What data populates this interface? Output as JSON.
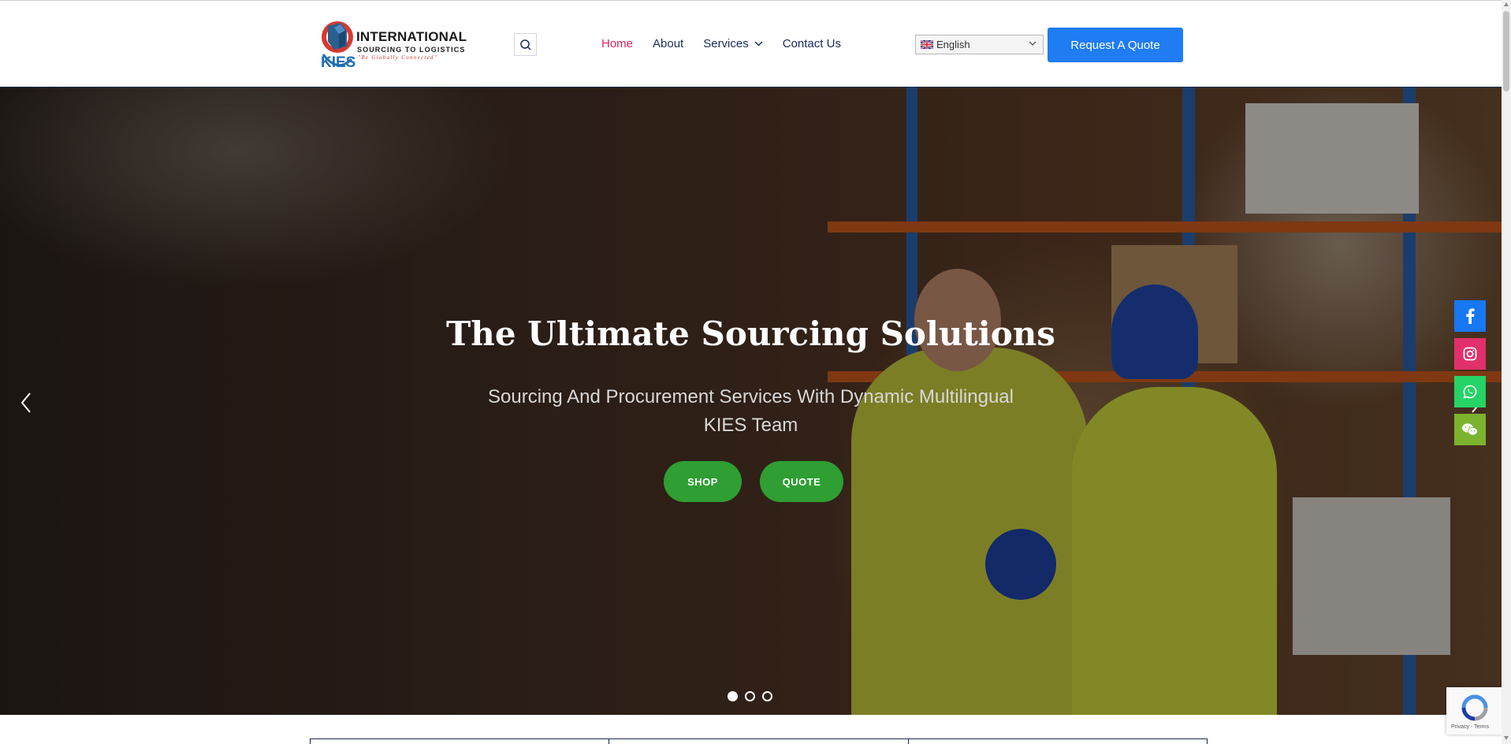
{
  "brand": {
    "name_line1": "INTERNATIONAL",
    "name_line2": "SOURCING TO LOGISTICS",
    "tagline": "\"Be Globally Connected\"",
    "mark_text": "KIES"
  },
  "nav": {
    "items": [
      {
        "label": "Home",
        "active": true
      },
      {
        "label": "About",
        "active": false
      },
      {
        "label": "Services",
        "active": false,
        "has_dropdown": true
      },
      {
        "label": "Contact Us",
        "active": false
      }
    ]
  },
  "language": {
    "selected": "English",
    "flag": "uk-flag-icon"
  },
  "header": {
    "quote_button": "Request A Quote"
  },
  "hero": {
    "title": "The Ultimate Sourcing Solutions",
    "subtitle": "Sourcing And Procurement Services With Dynamic Multilingual KIES Team",
    "buttons": {
      "shop": "SHOP",
      "quote": "QUOTE"
    },
    "slides_total": 3,
    "active_slide": 1
  },
  "social": [
    {
      "name": "facebook-icon",
      "color": "#1877f2"
    },
    {
      "name": "instagram-icon",
      "color": "#e1306c"
    },
    {
      "name": "whatsapp-icon",
      "color": "#25d366"
    },
    {
      "name": "wechat-icon",
      "color": "#7bb32e"
    }
  ],
  "recaptcha": {
    "text": "Privacy - Terms"
  },
  "colors": {
    "accent": "#1f7cf2",
    "active_nav": "#e0245e",
    "nav_text": "#1b2a5a",
    "hero_button": "#2f9e33"
  }
}
